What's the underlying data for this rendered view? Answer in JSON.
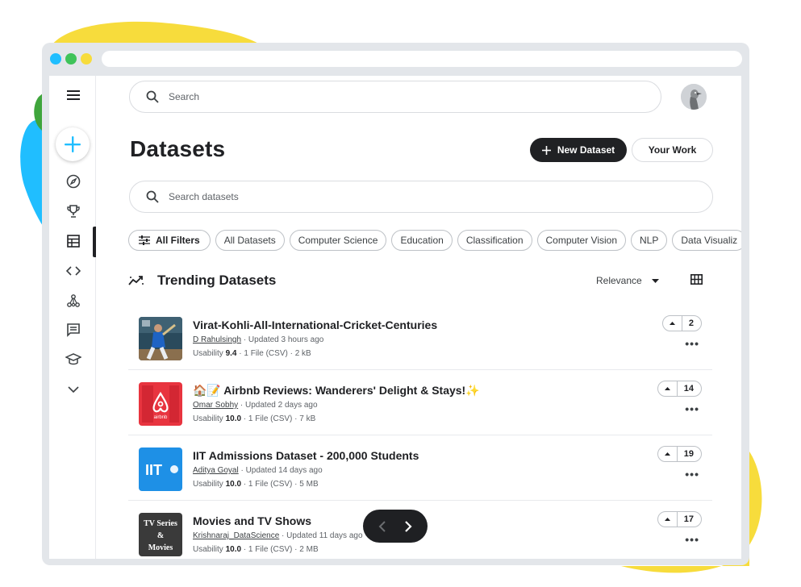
{
  "colors": {
    "blob_yellow": "#f7dc3c",
    "blob_blue": "#20beff",
    "blob_green": "#3fa53c",
    "window_dot_blue": "#20beff",
    "window_dot_green": "#3fc35a",
    "window_dot_yellow": "#f7dc3c",
    "create_plus": "#20beff",
    "primary_dark": "#202124"
  },
  "sidebar": {
    "items": [
      {
        "icon": "menu-icon"
      },
      {
        "icon": "create-plus-icon"
      },
      {
        "icon": "compass-icon"
      },
      {
        "icon": "trophy-icon"
      },
      {
        "icon": "table-icon",
        "active": true
      },
      {
        "icon": "code-icon"
      },
      {
        "icon": "models-icon"
      },
      {
        "icon": "discussion-icon"
      },
      {
        "icon": "learn-icon"
      },
      {
        "icon": "chevron-down-icon"
      }
    ]
  },
  "header": {
    "search_placeholder": "Search"
  },
  "page": {
    "title": "Datasets",
    "new_dataset_label": "New Dataset",
    "your_work_label": "Your Work",
    "search_datasets_placeholder": "Search datasets"
  },
  "filters": {
    "all_filters_label": "All Filters",
    "chips": [
      "All Datasets",
      "Computer Science",
      "Education",
      "Classification",
      "Computer Vision",
      "NLP",
      "Data Visualiz"
    ]
  },
  "trending": {
    "title": "Trending Datasets",
    "sort_label": "Relevance",
    "datasets": [
      {
        "title": "Virat-Kohli-All-International-Cricket-Centuries",
        "author": "D Rahulsingh",
        "updated": " · Updated 3 hours ago",
        "usability_label": "Usability ",
        "usability": "9.4",
        "details": " · 1 File (CSV) · 2 kB",
        "votes": "2"
      },
      {
        "title": "🏠📝 Airbnb Reviews: Wanderers' Delight & Stays!✨",
        "author": "Omar Sobhy",
        "updated": " · Updated 2 days ago",
        "usability_label": "Usability ",
        "usability": "10.0",
        "details": " · 1 File (CSV) · 7 kB",
        "votes": "14"
      },
      {
        "title": "IIT Admissions Dataset - 200,000 Students",
        "author": "Aditya Goyal",
        "updated": " · Updated 14 days ago",
        "usability_label": "Usability ",
        "usability": "10.0",
        "details": " · 1 File (CSV) · 5 MB",
        "votes": "19"
      },
      {
        "title": "Movies and TV Shows",
        "author": "Krishnaraj_DataScience",
        "updated": " · Updated 11 days ago",
        "usability_label": "Usability ",
        "usability": "10.0",
        "details": " · 1 File (CSV) · 2 MB",
        "votes": "17"
      }
    ],
    "thumbnails": {
      "iit_text": "IIT",
      "tv_text_1": "TV Series",
      "tv_text_2": "&",
      "tv_text_3": "Movies",
      "airbnb_text": "airbnb"
    }
  },
  "more_label": "•••"
}
